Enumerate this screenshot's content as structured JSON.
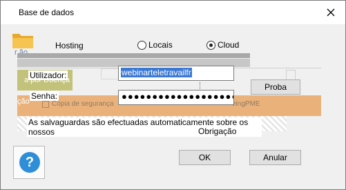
{
  "window": {
    "title": "Base de dados",
    "close_label": "✕"
  },
  "hosting": {
    "label": "Hosting",
    "options": [
      {
        "label": "Locais",
        "selected": false
      },
      {
        "label": "Cloud",
        "selected": true
      }
    ]
  },
  "login": {
    "user_label": "Utilizador:",
    "user_value": "webinarteletravailfr",
    "password_label": "Senha:",
    "password_value": "●●●●●●●●●●●●●●●●●●●●",
    "test_button": "Proba"
  },
  "background_ghost": {
    "ao": "r ão",
    "doenca": "a por Doença",
    "cao": "ção",
    "backup_checkbox": "Cópia de segurança",
    "pme": "eingPME"
  },
  "notice": {
    "text": "As salvaguardas são efectuadas automaticamente sobre os nossos",
    "continuation": "Obrigação"
  },
  "footer": {
    "help_icon": "?",
    "ok_button": "OK",
    "cancel_button": "Anular"
  },
  "colors": {
    "accent_selection": "#3b78d4",
    "help_icon": "#2f8ed8",
    "folder": "#f0b83a"
  }
}
